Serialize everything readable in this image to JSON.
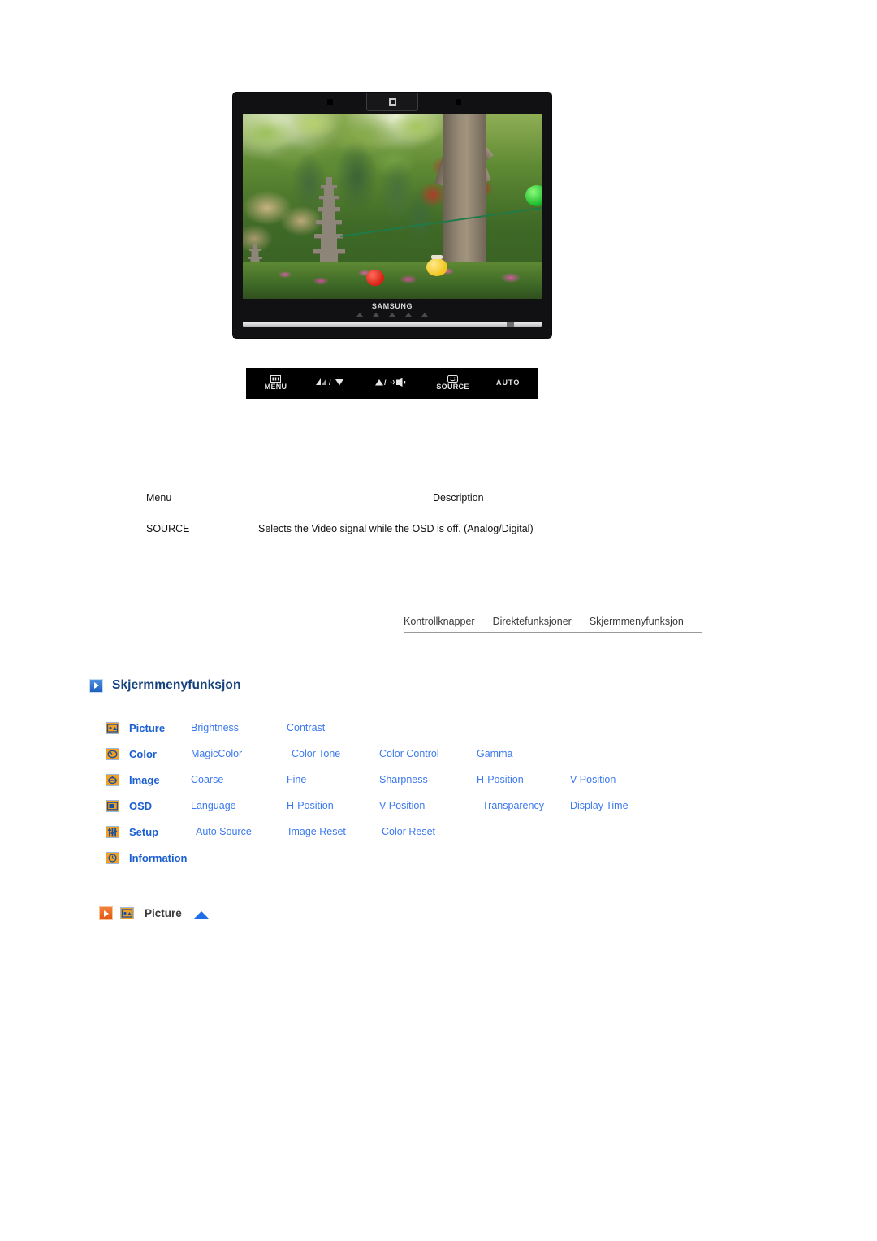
{
  "monitor": {
    "brand_logo": "SAMSUNG",
    "bezel_tab_icon": "power-indicator-icon",
    "screen_photo_alt": "korean-garden-with-stone-pagoda-and-paper-lanterns"
  },
  "control_bar": {
    "buttons": [
      {
        "label": "MENU",
        "icon": "menu-icon"
      },
      {
        "label": "/",
        "icon": "magicbright-down-icon",
        "glyph": "▼"
      },
      {
        "label": "/",
        "icon": "up-volume-icon",
        "glyph": "▲"
      },
      {
        "label": "SOURCE",
        "icon": "source-icon"
      },
      {
        "label": "AUTO",
        "icon": ""
      }
    ]
  },
  "menu_table": {
    "headers": {
      "menu": "Menu",
      "description": "Description"
    },
    "rows": [
      {
        "menu": "SOURCE",
        "description": "Selects the Video signal while the OSD is off. (Analog/Digital)"
      }
    ]
  },
  "tabs": [
    {
      "label": "Kontrollknapper"
    },
    {
      "label": "Direktefunksjoner"
    },
    {
      "label": "Skjermmenyfunksjon"
    }
  ],
  "section": {
    "title": "Skjermmenyfunksjon",
    "icon": "blue-play-badge-icon"
  },
  "osd_map": [
    {
      "icon": "picture-icon",
      "category": "Picture",
      "items": [
        "Brightness",
        "Contrast"
      ]
    },
    {
      "icon": "color-icon",
      "category": "Color",
      "items": [
        "MagicColor",
        "Color Tone",
        "Color Control",
        "Gamma"
      ]
    },
    {
      "icon": "image-icon",
      "category": "Image",
      "items": [
        "Coarse",
        "Fine",
        "Sharpness",
        "H-Position",
        "V-Position"
      ]
    },
    {
      "icon": "osd-icon",
      "category": "OSD",
      "items": [
        "Language",
        "H-Position",
        "V-Position",
        "Transparency",
        "Display Time"
      ]
    },
    {
      "icon": "setup-icon",
      "category": "Setup",
      "items": [
        "Auto Source",
        "Image Reset",
        "Color Reset"
      ]
    },
    {
      "icon": "information-icon",
      "category": "Information",
      "items": []
    }
  ],
  "picture_anchor": {
    "label": "Picture",
    "play_icon": "orange-play-badge-icon",
    "menu_icon": "picture-icon",
    "top_icon": "scroll-to-top-triangle-icon"
  },
  "colors": {
    "heading": "#16427d",
    "category_link": "#1b5fd0",
    "item_link": "#3b79ef",
    "icon_fill": "#f0a024",
    "icon_border": "#9fb8d8",
    "tab_text": "#3a3a3a",
    "rule": "#9a9a9a"
  }
}
